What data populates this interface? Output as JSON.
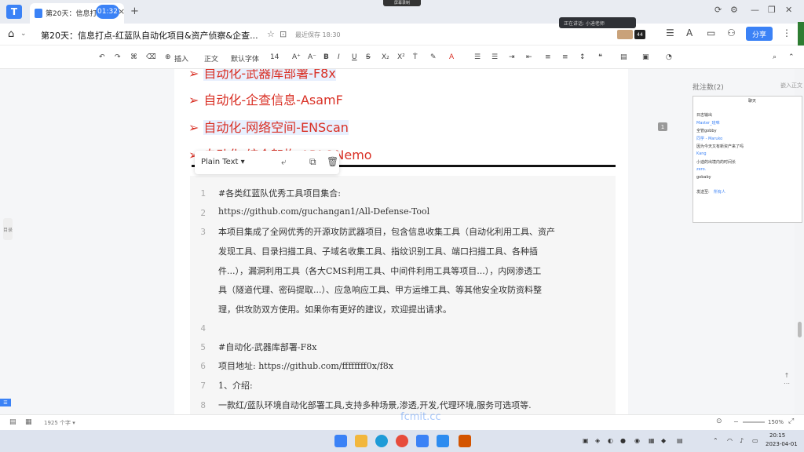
{
  "browser": {
    "tab_title": "第20天：信息打点-红",
    "timer": "01:32",
    "new_tab": "+",
    "tab_close": "×",
    "recording_label": "屏幕录制"
  },
  "header": {
    "doc_title": "第20天：信息打点-红蓝队自动化项目&资产侦察&企查...",
    "save_status": "最近保存 18:30",
    "speaking_label": "正在讲话: 小迪老师",
    "avatar_count": "44",
    "share_label": "分享"
  },
  "format_toolbar": {
    "insert": "插入",
    "paragraph_style": "正文",
    "font_family": "默认字体",
    "font_size": "14"
  },
  "document": {
    "headings": [
      {
        "text": "自动化-武器库部署-F8x"
      },
      {
        "text": "自动化-企查信息-AsamF"
      },
      {
        "text": "自动化-网络空间-ENScan"
      },
      {
        "text": "自动化-综合架构-ARL&Nemo"
      }
    ],
    "code_block": {
      "language": "Plain Text",
      "lines": [
        {
          "num": "1",
          "text": "#各类红蓝队优秀工具项目集合:"
        },
        {
          "num": "2",
          "text": "https://github.com/guchangan1/All-Defense-Tool"
        },
        {
          "num": "3",
          "text": "本项目集成了全网优秀的开源攻防武器项目，包含信息收集工具（自动化利用工具、资产"
        },
        {
          "num": "",
          "text": "发现工具、目录扫描工具、子域名收集工具、指纹识别工具、端口扫描工具、各种插"
        },
        {
          "num": "",
          "text": "件...），漏洞利用工具（各大CMS利用工具、中间件利用工具等项目...），内网渗透工"
        },
        {
          "num": "",
          "text": "具（隧道代理、密码提取...）、应急响应工具、甲方运维工具、等其他安全攻防资料整"
        },
        {
          "num": "",
          "text": "理，供攻防双方使用。如果你有更好的建议，欢迎提出请求。"
        },
        {
          "num": "4",
          "text": ""
        },
        {
          "num": "5",
          "text": "#自动化-武器库部署-F8x"
        },
        {
          "num": "6",
          "text": "项目地址: https://github.com/ffffffff0x/f8x"
        },
        {
          "num": "7",
          "text": "1、介绍:"
        },
        {
          "num": "8",
          "text": "一款红/蓝队环境自动化部署工具,支持多种场景,渗透,开发,代理环境,服务可选项等."
        }
      ]
    },
    "page_badge": "1",
    "left_rail": "目录"
  },
  "right_panel": {
    "title": "批注数(2)",
    "action": "嵌入正文",
    "chat": {
      "title": "聊天",
      "messages": [
        {
          "name": "",
          "text": "日志输出"
        },
        {
          "name": "Master_班味",
          "text": ""
        },
        {
          "name": "",
          "text": "全管gobby"
        },
        {
          "name": "同学 - Maruko",
          "text": ""
        },
        {
          "name": "",
          "text": "因为今天又有新资产来了吗"
        },
        {
          "name": "Kang",
          "text": ""
        },
        {
          "name": "",
          "text": "小迪的出境内的时间长"
        },
        {
          "name": "zero.",
          "text": ""
        },
        {
          "name": "",
          "text": "gobaby"
        }
      ],
      "send_to": "发送至:",
      "recipient": "所有人"
    }
  },
  "status": {
    "word_count": "1925 个字",
    "zoom": "150%"
  },
  "watermark": "fcmit.cc",
  "taskbar": {
    "time": "20:15",
    "date": "2023-04-01"
  }
}
